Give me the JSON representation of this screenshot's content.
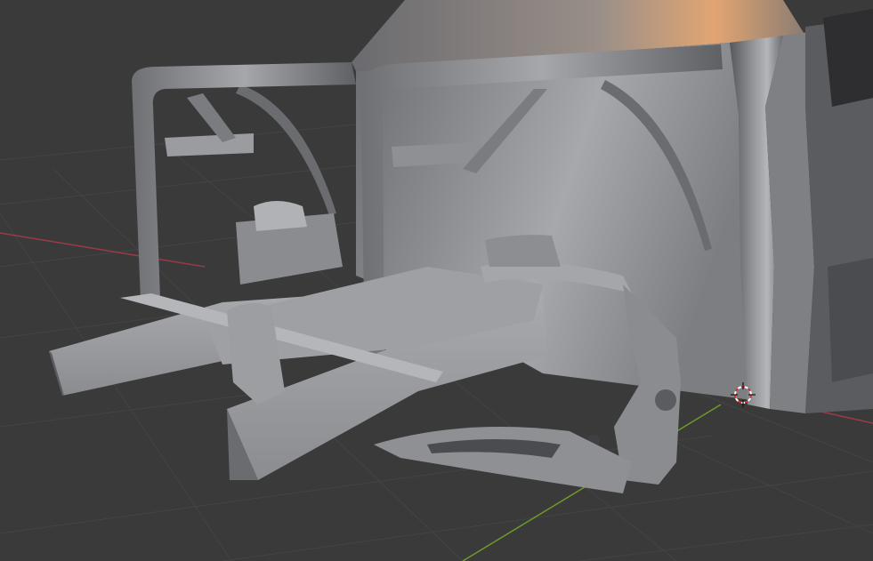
{
  "viewport": {
    "background": "#3a3a3a",
    "grid_color": "#444444",
    "x_axis_color": "#9a3a48",
    "y_axis_color": "#6e9a2a"
  },
  "model": {
    "base_color": "#8c8e92",
    "highlight_color": "#b8babe",
    "shadow_color": "#3e4044",
    "cab_light_color": "#e2a572"
  },
  "cursor_3d": {
    "icon": "3d-cursor-icon",
    "ring_color_a": "#e03030",
    "ring_color_b": "#ffffff"
  }
}
